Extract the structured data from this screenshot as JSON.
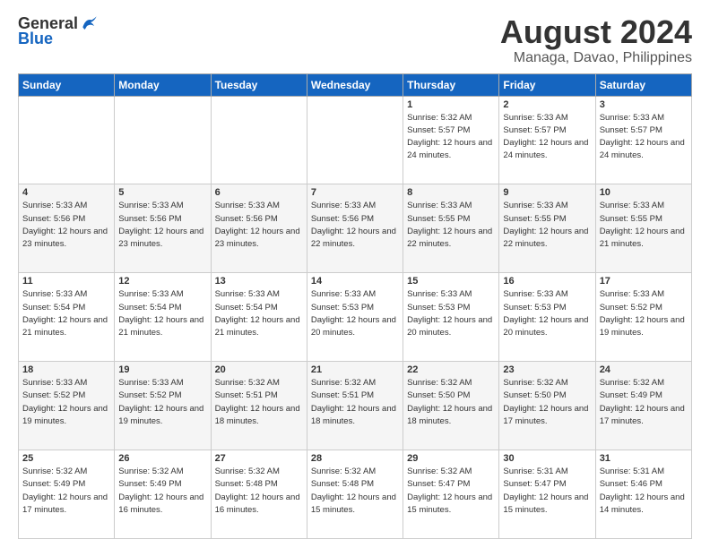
{
  "header": {
    "logo": {
      "general": "General",
      "blue": "Blue"
    },
    "title": "August 2024",
    "location": "Managa, Davao, Philippines"
  },
  "weekdays": [
    "Sunday",
    "Monday",
    "Tuesday",
    "Wednesday",
    "Thursday",
    "Friday",
    "Saturday"
  ],
  "weeks": [
    [
      {
        "day": "",
        "sunrise": "",
        "sunset": "",
        "daylight": ""
      },
      {
        "day": "",
        "sunrise": "",
        "sunset": "",
        "daylight": ""
      },
      {
        "day": "",
        "sunrise": "",
        "sunset": "",
        "daylight": ""
      },
      {
        "day": "",
        "sunrise": "",
        "sunset": "",
        "daylight": ""
      },
      {
        "day": "1",
        "sunrise": "Sunrise: 5:32 AM",
        "sunset": "Sunset: 5:57 PM",
        "daylight": "Daylight: 12 hours and 24 minutes."
      },
      {
        "day": "2",
        "sunrise": "Sunrise: 5:33 AM",
        "sunset": "Sunset: 5:57 PM",
        "daylight": "Daylight: 12 hours and 24 minutes."
      },
      {
        "day": "3",
        "sunrise": "Sunrise: 5:33 AM",
        "sunset": "Sunset: 5:57 PM",
        "daylight": "Daylight: 12 hours and 24 minutes."
      }
    ],
    [
      {
        "day": "4",
        "sunrise": "Sunrise: 5:33 AM",
        "sunset": "Sunset: 5:56 PM",
        "daylight": "Daylight: 12 hours and 23 minutes."
      },
      {
        "day": "5",
        "sunrise": "Sunrise: 5:33 AM",
        "sunset": "Sunset: 5:56 PM",
        "daylight": "Daylight: 12 hours and 23 minutes."
      },
      {
        "day": "6",
        "sunrise": "Sunrise: 5:33 AM",
        "sunset": "Sunset: 5:56 PM",
        "daylight": "Daylight: 12 hours and 23 minutes."
      },
      {
        "day": "7",
        "sunrise": "Sunrise: 5:33 AM",
        "sunset": "Sunset: 5:56 PM",
        "daylight": "Daylight: 12 hours and 22 minutes."
      },
      {
        "day": "8",
        "sunrise": "Sunrise: 5:33 AM",
        "sunset": "Sunset: 5:55 PM",
        "daylight": "Daylight: 12 hours and 22 minutes."
      },
      {
        "day": "9",
        "sunrise": "Sunrise: 5:33 AM",
        "sunset": "Sunset: 5:55 PM",
        "daylight": "Daylight: 12 hours and 22 minutes."
      },
      {
        "day": "10",
        "sunrise": "Sunrise: 5:33 AM",
        "sunset": "Sunset: 5:55 PM",
        "daylight": "Daylight: 12 hours and 21 minutes."
      }
    ],
    [
      {
        "day": "11",
        "sunrise": "Sunrise: 5:33 AM",
        "sunset": "Sunset: 5:54 PM",
        "daylight": "Daylight: 12 hours and 21 minutes."
      },
      {
        "day": "12",
        "sunrise": "Sunrise: 5:33 AM",
        "sunset": "Sunset: 5:54 PM",
        "daylight": "Daylight: 12 hours and 21 minutes."
      },
      {
        "day": "13",
        "sunrise": "Sunrise: 5:33 AM",
        "sunset": "Sunset: 5:54 PM",
        "daylight": "Daylight: 12 hours and 21 minutes."
      },
      {
        "day": "14",
        "sunrise": "Sunrise: 5:33 AM",
        "sunset": "Sunset: 5:53 PM",
        "daylight": "Daylight: 12 hours and 20 minutes."
      },
      {
        "day": "15",
        "sunrise": "Sunrise: 5:33 AM",
        "sunset": "Sunset: 5:53 PM",
        "daylight": "Daylight: 12 hours and 20 minutes."
      },
      {
        "day": "16",
        "sunrise": "Sunrise: 5:33 AM",
        "sunset": "Sunset: 5:53 PM",
        "daylight": "Daylight: 12 hours and 20 minutes."
      },
      {
        "day": "17",
        "sunrise": "Sunrise: 5:33 AM",
        "sunset": "Sunset: 5:52 PM",
        "daylight": "Daylight: 12 hours and 19 minutes."
      }
    ],
    [
      {
        "day": "18",
        "sunrise": "Sunrise: 5:33 AM",
        "sunset": "Sunset: 5:52 PM",
        "daylight": "Daylight: 12 hours and 19 minutes."
      },
      {
        "day": "19",
        "sunrise": "Sunrise: 5:33 AM",
        "sunset": "Sunset: 5:52 PM",
        "daylight": "Daylight: 12 hours and 19 minutes."
      },
      {
        "day": "20",
        "sunrise": "Sunrise: 5:32 AM",
        "sunset": "Sunset: 5:51 PM",
        "daylight": "Daylight: 12 hours and 18 minutes."
      },
      {
        "day": "21",
        "sunrise": "Sunrise: 5:32 AM",
        "sunset": "Sunset: 5:51 PM",
        "daylight": "Daylight: 12 hours and 18 minutes."
      },
      {
        "day": "22",
        "sunrise": "Sunrise: 5:32 AM",
        "sunset": "Sunset: 5:50 PM",
        "daylight": "Daylight: 12 hours and 18 minutes."
      },
      {
        "day": "23",
        "sunrise": "Sunrise: 5:32 AM",
        "sunset": "Sunset: 5:50 PM",
        "daylight": "Daylight: 12 hours and 17 minutes."
      },
      {
        "day": "24",
        "sunrise": "Sunrise: 5:32 AM",
        "sunset": "Sunset: 5:49 PM",
        "daylight": "Daylight: 12 hours and 17 minutes."
      }
    ],
    [
      {
        "day": "25",
        "sunrise": "Sunrise: 5:32 AM",
        "sunset": "Sunset: 5:49 PM",
        "daylight": "Daylight: 12 hours and 17 minutes."
      },
      {
        "day": "26",
        "sunrise": "Sunrise: 5:32 AM",
        "sunset": "Sunset: 5:49 PM",
        "daylight": "Daylight: 12 hours and 16 minutes."
      },
      {
        "day": "27",
        "sunrise": "Sunrise: 5:32 AM",
        "sunset": "Sunset: 5:48 PM",
        "daylight": "Daylight: 12 hours and 16 minutes."
      },
      {
        "day": "28",
        "sunrise": "Sunrise: 5:32 AM",
        "sunset": "Sunset: 5:48 PM",
        "daylight": "Daylight: 12 hours and 15 minutes."
      },
      {
        "day": "29",
        "sunrise": "Sunrise: 5:32 AM",
        "sunset": "Sunset: 5:47 PM",
        "daylight": "Daylight: 12 hours and 15 minutes."
      },
      {
        "day": "30",
        "sunrise": "Sunrise: 5:31 AM",
        "sunset": "Sunset: 5:47 PM",
        "daylight": "Daylight: 12 hours and 15 minutes."
      },
      {
        "day": "31",
        "sunrise": "Sunrise: 5:31 AM",
        "sunset": "Sunset: 5:46 PM",
        "daylight": "Daylight: 12 hours and 14 minutes."
      }
    ]
  ]
}
